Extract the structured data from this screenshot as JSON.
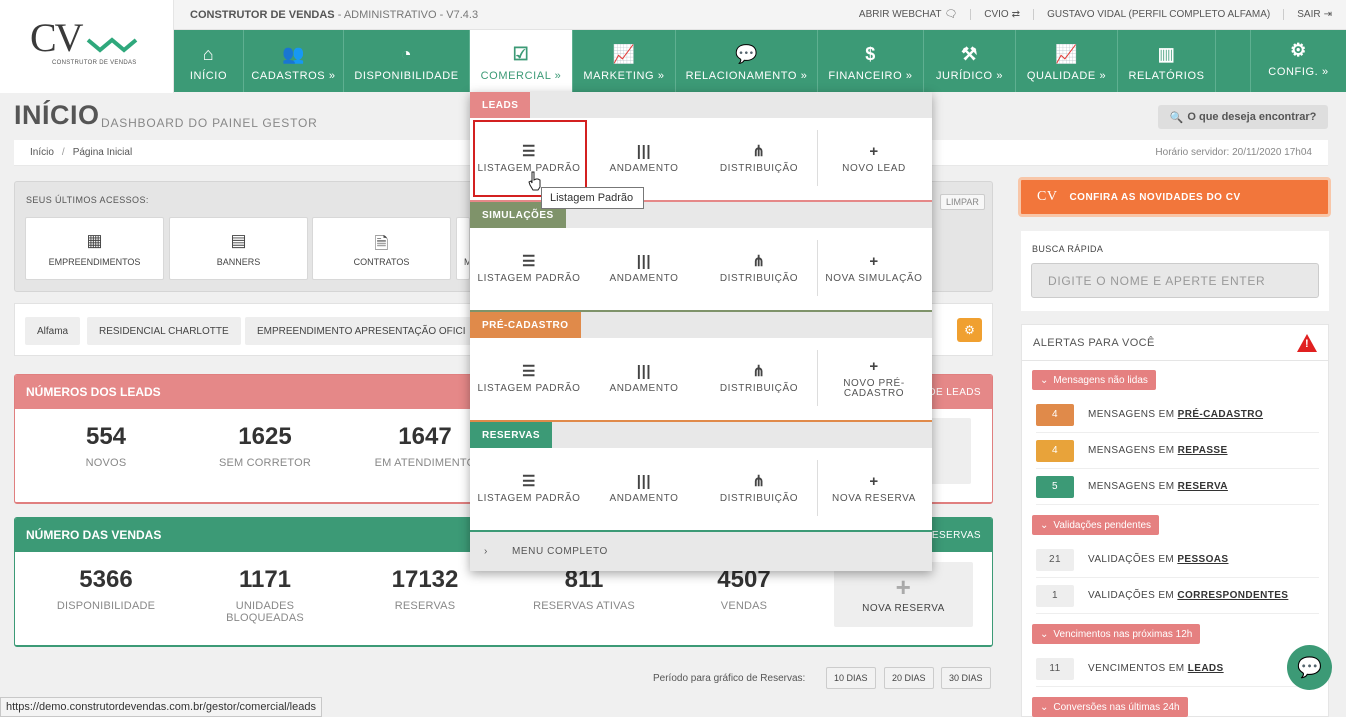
{
  "app": {
    "title": "CONSTRUTOR DE VENDAS",
    "subtitle": "- ADMINISTRATIVO - V7.4.3",
    "logo_text": "CV",
    "logo_sub": "CONSTRUTOR DE VENDAS"
  },
  "toplinks": [
    "ABRIR WEBCHAT",
    "CVIO",
    "GUSTAVO VIDAL (PERFIL COMPLETO ALFAMA)",
    "SAIR"
  ],
  "nav": [
    {
      "label": "INÍCIO",
      "icon": "home-icon"
    },
    {
      "label": "CADASTROS",
      "icon": "users-icon"
    },
    {
      "label": "DISPONIBILIDADE",
      "icon": "dashboard-icon"
    },
    {
      "label": "COMERCIAL",
      "icon": "checkbox-icon"
    },
    {
      "label": "MARKETING",
      "icon": "chart-line-icon"
    },
    {
      "label": "RELACIONAMENTO",
      "icon": "chat-icon"
    },
    {
      "label": "FINANCEIRO",
      "icon": "dollar-icon"
    },
    {
      "label": "JURÍDICO",
      "icon": "gavel-icon"
    },
    {
      "label": "QUALIDADE",
      "icon": "chart-area-icon"
    },
    {
      "label": "RELATÓRIOS",
      "icon": "bar-chart-icon"
    },
    {
      "label": "CONFIG.",
      "icon": "gear-icon"
    }
  ],
  "page": {
    "title": "INÍCIO",
    "subtitle": "DASHBOARD DO PAINEL GESTOR",
    "search": "O que deseja encontrar?"
  },
  "breadcrumb": {
    "home": "Início",
    "current": "Página Inicial",
    "server": "Horário servidor: 20/11/2020 17h04"
  },
  "recent": {
    "title": "SEUS ÚLTIMOS ACESSOS:",
    "clear": "LIMPAR",
    "items": [
      "EMPREENDIMENTOS",
      "BANNERS",
      "CONTRATOS",
      "M"
    ]
  },
  "empreendimentos": [
    "Alfama",
    "RESIDENCIAL CHARLOTTE",
    "EMPREENDIMENTO APRESENTAÇÃO OFICI"
  ],
  "leads": {
    "title": "NÚMEROS DOS LEADS",
    "right": "DE LEADS",
    "stats": [
      {
        "num": "554",
        "label": "NOVOS"
      },
      {
        "num": "1625",
        "label": "SEM CORRETOR"
      },
      {
        "num": "1647",
        "label": "EM ATENDIMENTO"
      }
    ]
  },
  "vendas": {
    "title": "NÚMERO DAS VENDAS",
    "right": "RESERVAS",
    "stats": [
      {
        "num": "5366",
        "label": "DISPONIBILIDADE"
      },
      {
        "num": "1171",
        "label": "UNIDADES BLOQUEADAS"
      },
      {
        "num": "17132",
        "label": "RESERVAS"
      },
      {
        "num": "811",
        "label": "RESERVAS ATIVAS"
      },
      {
        "num": "4507",
        "label": "VENDAS"
      }
    ],
    "nova_reserva": "NOVA RESERVA"
  },
  "periodo": {
    "label": "Período para gráfico de Reservas:",
    "buttons": [
      "10 DIAS",
      "20 DIAS",
      "30 DIAS"
    ]
  },
  "novidades": {
    "label": "CONFIRA AS NOVIDADES DO CV",
    "logo": "CV"
  },
  "busca": {
    "title": "BUSCA RÁPIDA",
    "placeholder": "DIGITE O NOME E APERTE ENTER"
  },
  "alertas": {
    "title": "ALERTAS PARA VOCÊ",
    "groups": [
      {
        "label": "Mensagens não lidas"
      },
      {
        "label": "Validações pendentes"
      },
      {
        "label": "Vencimentos nas próximas 12h"
      },
      {
        "label": "Conversões nas últimas 24h"
      }
    ],
    "rows": [
      {
        "count": "4",
        "prefix": "MENSAGENS EM",
        "link": "PRÉ-CADASTRO",
        "color": "#e08a4a"
      },
      {
        "count": "4",
        "prefix": "MENSAGENS EM",
        "link": "REPASSE",
        "color": "#e8a33a"
      },
      {
        "count": "5",
        "prefix": "MENSAGENS EM",
        "link": "RESERVA",
        "color": "#3c9a76"
      },
      {
        "count": "21",
        "prefix": "VALIDAÇÕES EM",
        "link": "PESSOAS",
        "color": "#eeeeee"
      },
      {
        "count": "1",
        "prefix": "VALIDAÇÕES EM",
        "link": "CORRESPONDENTES",
        "color": "#eeeeee"
      },
      {
        "count": "11",
        "prefix": "VENCIMENTOS EM",
        "link": "LEADS",
        "color": "#eeeeee"
      }
    ]
  },
  "dropdown": {
    "sections": [
      {
        "tag": "LEADS",
        "color": "#e58888",
        "items": [
          "LISTAGEM PADRÃO",
          "ANDAMENTO",
          "DISTRIBUIÇÃO",
          "NOVO LEAD"
        ]
      },
      {
        "tag": "SIMULAÇÕES",
        "color": "#7f936a",
        "items": [
          "LISTAGEM PADRÃO",
          "ANDAMENTO",
          "DISTRIBUIÇÃO",
          "NOVA SIMULAÇÃO"
        ]
      },
      {
        "tag": "PRÉ-CADASTRO",
        "color": "#e08a4a",
        "items": [
          "LISTAGEM PADRÃO",
          "ANDAMENTO",
          "DISTRIBUIÇÃO",
          "NOVO PRÉ-CADASTRO"
        ]
      },
      {
        "tag": "RESERVAS",
        "color": "#3c9a76",
        "items": [
          "LISTAGEM PADRÃO",
          "ANDAMENTO",
          "DISTRIBUIÇÃO",
          "NOVA RESERVA"
        ]
      }
    ],
    "footer": "MENU COMPLETO"
  },
  "tooltip": "Listagem Padrão",
  "statusbar": "https://demo.construtordevendas.com.br/gestor/comercial/leads"
}
